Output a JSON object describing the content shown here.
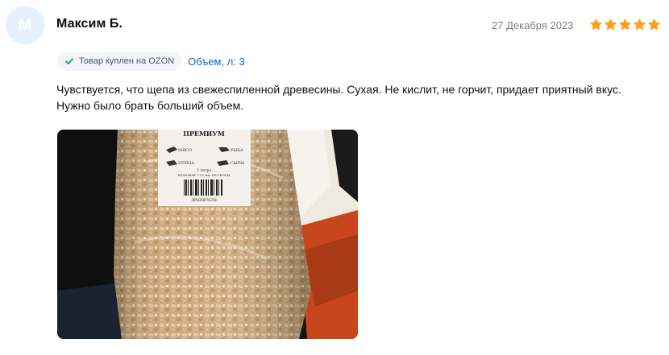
{
  "review": {
    "avatar_initial": "М",
    "author": "Максим Б.",
    "date": "27 Декабря 2023",
    "rating": 5,
    "purchase_badge": "Товар куплен на OZON",
    "variant_link": "Объем, л: 3",
    "text": "Чувствуется, что щепа из свежеспиленной древесины. Сухая. Не кислит, не горчит, придает приятный вкус. Нужно было брать больший объем."
  },
  "photo": {
    "label_title": "ПРЕМИУМ",
    "label_items": [
      "МЯСО",
      "РЫБА",
      "ПТИЦА",
      "СЫРЫ"
    ],
    "label_volume": "3 литра",
    "label_note": "ФРАКЦИЯ 7-15 мм, БЕЗ КОРЫ",
    "barcode_text": "2050358555258"
  },
  "colors": {
    "star": "#f9a21a",
    "link": "#0d64d8",
    "check": "#12a45a",
    "avatar_bg": "#e6f1fb"
  }
}
